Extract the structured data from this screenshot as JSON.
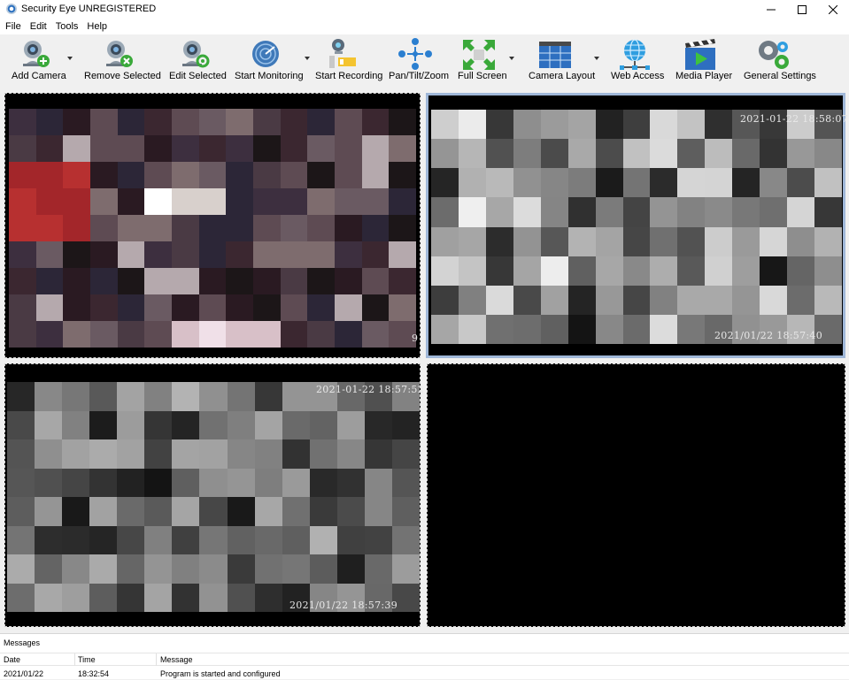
{
  "window": {
    "title": "Security Eye UNREGISTERED"
  },
  "menu": [
    "File",
    "Edit",
    "Tools",
    "Help"
  ],
  "toolbar": {
    "add_camera": "Add Camera",
    "remove_selected": "Remove Selected",
    "edit_selected": "Edit Selected",
    "start_monitoring": "Start Monitoring",
    "start_recording": "Start Recording",
    "pan_tilt_zoom": "Pan/Tilt/Zoom",
    "full_screen": "Full Screen",
    "camera_layout": "Camera Layout",
    "web_access": "Web Access",
    "media_player": "Media Player",
    "general_settings": "General Settings"
  },
  "cameras": {
    "cam1": {
      "timestamp_right_edge": "9"
    },
    "cam2": {
      "timestamp_top": "2021-01-22 18:58:07",
      "timestamp_bottom": "2021/01/22 18:57:40"
    },
    "cam3": {
      "timestamp_top": "2021-01-22 18:57:52",
      "timestamp_bottom": "2021/01/22 18:57:39"
    }
  },
  "messages": {
    "title": "Messages",
    "columns": [
      "Date",
      "Time",
      "Message"
    ],
    "rows": [
      {
        "date": "2021/01/22",
        "time": "18:32:54",
        "message": "Program is started and configured"
      }
    ]
  },
  "colors": {
    "selected_border": "#9fb7d8",
    "toolbar_bg": "#f0f0f0"
  }
}
